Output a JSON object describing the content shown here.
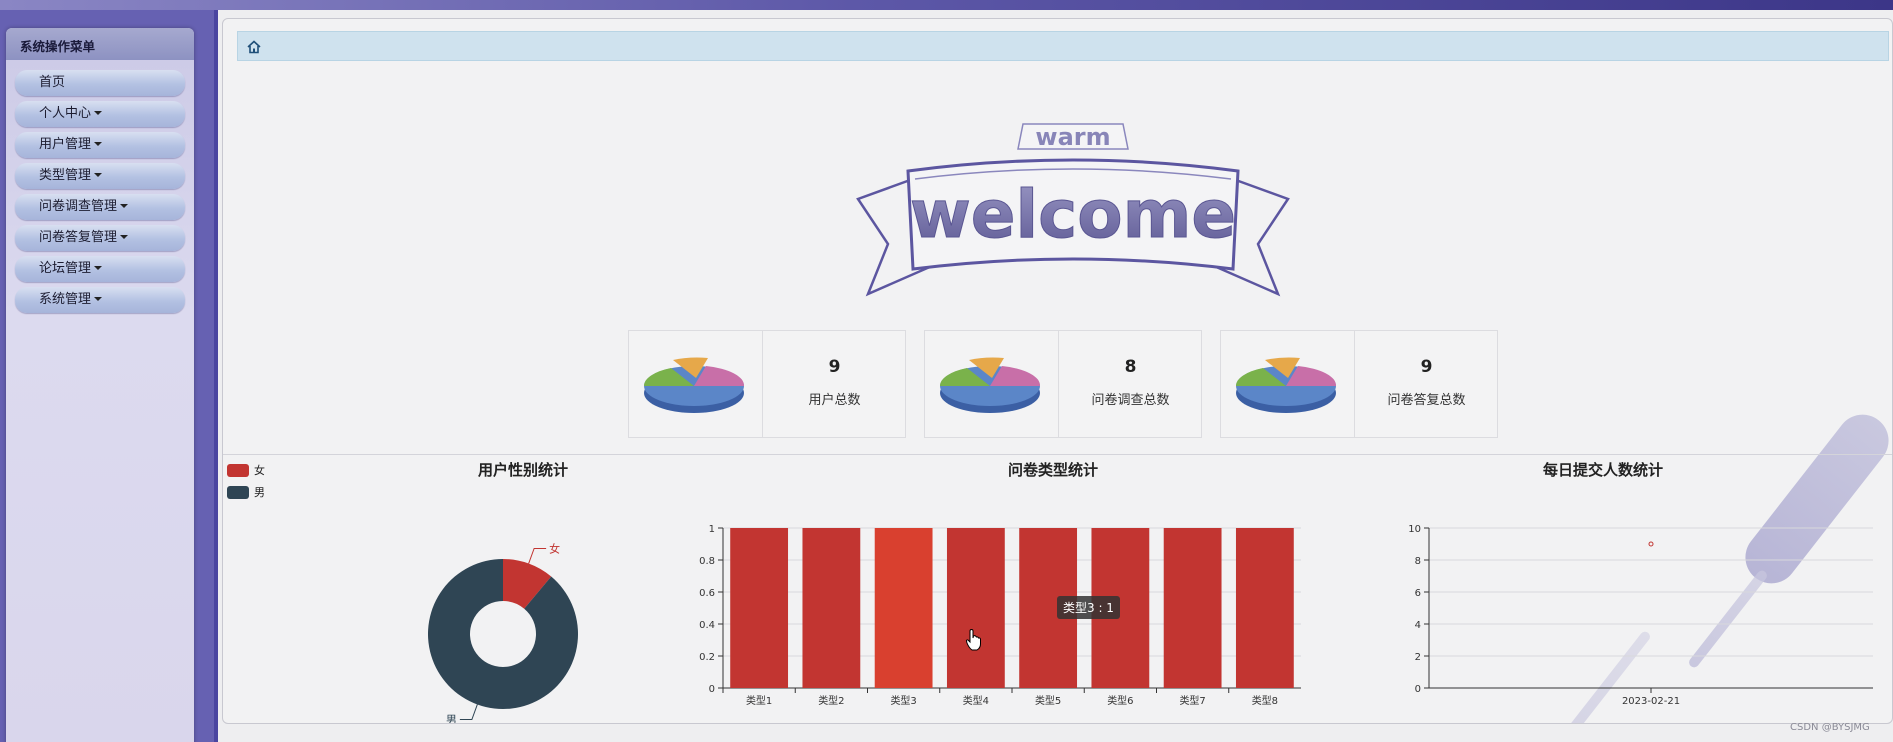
{
  "sidebar": {
    "title": "系统操作菜单",
    "items": [
      {
        "label": "首页",
        "dropdown": false
      },
      {
        "label": "个人中心",
        "dropdown": true
      },
      {
        "label": "用户管理",
        "dropdown": true
      },
      {
        "label": "类型管理",
        "dropdown": true
      },
      {
        "label": "问卷调查管理",
        "dropdown": true
      },
      {
        "label": "问卷答复管理",
        "dropdown": true
      },
      {
        "label": "论坛管理",
        "dropdown": true
      },
      {
        "label": "系统管理",
        "dropdown": true
      }
    ]
  },
  "breadcrumb": {
    "icon": "home-icon"
  },
  "welcome": {
    "small": "warm",
    "big": "welcome"
  },
  "stats": [
    {
      "value": "9",
      "label": "用户总数"
    },
    {
      "value": "8",
      "label": "问卷调查总数"
    },
    {
      "value": "9",
      "label": "问卷答复总数"
    }
  ],
  "charts": {
    "gender": {
      "title": "用户性别统计"
    },
    "types": {
      "title": "问卷类型统计"
    },
    "daily": {
      "title": "每日提交人数统计"
    },
    "tooltip": "类型3 : 1"
  },
  "chart_data": [
    {
      "type": "pie",
      "title": "用户性别统计",
      "legend_position": "top-left",
      "series": [
        {
          "name": "女",
          "value": 1,
          "color": "#c23531"
        },
        {
          "name": "男",
          "value": 8,
          "color": "#2f4554"
        }
      ]
    },
    {
      "type": "bar",
      "title": "问卷类型统计",
      "categories": [
        "类型1",
        "类型2",
        "类型3",
        "类型4",
        "类型5",
        "类型6",
        "类型7",
        "类型8"
      ],
      "values": [
        1,
        1,
        1,
        1,
        1,
        1,
        1,
        1
      ],
      "ylim": [
        0,
        1
      ],
      "yticks": [
        "0",
        "0.2",
        "0.4",
        "0.6",
        "0.8",
        "1"
      ],
      "color": "#c23531",
      "grid": true
    },
    {
      "type": "scatter",
      "title": "每日提交人数统计",
      "categories": [
        "2023-02-21"
      ],
      "values": [
        9
      ],
      "ylim": [
        0,
        10
      ],
      "yticks": [
        "0",
        "2",
        "4",
        "6",
        "8",
        "10"
      ],
      "color": "#c23531",
      "grid": true
    }
  ],
  "watermark": "CSDN @BYSJMG"
}
